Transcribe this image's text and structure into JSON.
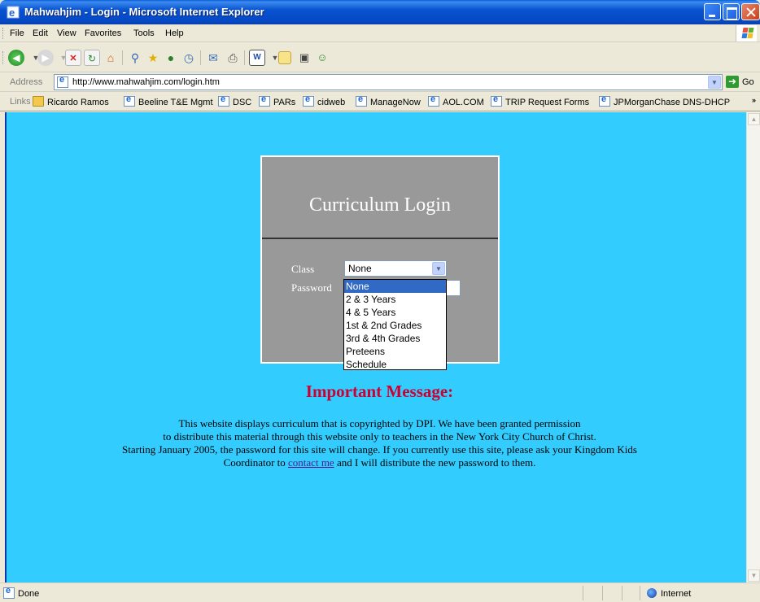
{
  "window": {
    "title": "Mahwahjim - Login - Microsoft Internet Explorer"
  },
  "menubar": {
    "items": [
      "File",
      "Edit",
      "View",
      "Favorites",
      "Tools",
      "Help"
    ]
  },
  "toolbar": {
    "icons": [
      "back-icon",
      "forward-icon",
      "stop-icon",
      "refresh-icon",
      "home-icon",
      "search-icon",
      "favorites-icon",
      "media-icon",
      "history-icon",
      "mail-icon",
      "print-icon",
      "edit-icon",
      "discuss-icon",
      "messenger-icon",
      "research-icon"
    ]
  },
  "addressbar": {
    "label": "Address",
    "url": "http://www.mahwahjim.com/login.htm",
    "go_label": "Go"
  },
  "linksbar": {
    "label": "Links",
    "items": [
      "Ricardo Ramos",
      "Beeline T&E Mgmt",
      "DSC",
      "PARs",
      "cidweb",
      "ManageNow",
      "AOL.COM",
      "TRIP Request Forms",
      "JPMorganChase DNS-DHCP"
    ]
  },
  "login": {
    "heading": "Curriculum Login",
    "class_label": "Class",
    "password_label": "Password",
    "class_value": "None",
    "options": [
      "None",
      "2 & 3 Years",
      "4 & 5 Years",
      "1st & 2nd Grades",
      "3rd & 4th Grades",
      "Preteens",
      "Schedule"
    ],
    "selected_index": 0
  },
  "message": {
    "title": "Important Message:",
    "line1": "This website displays curriculum that is copyrighted by DPI. We have been granted permission",
    "line2": "to distribute this material through this website only to teachers in the New York City Church of Christ.",
    "line3": "Starting January 2005, the password for this site will change. If you currently use this site, please ask your Kingdom Kids",
    "line4_before": "Coordinator to",
    "link": "contact me",
    "line4_after": "and I will distribute the new password to them."
  },
  "statusbar": {
    "status": "Done",
    "zone": "Internet"
  },
  "colors": {
    "page_background": "#33ccff",
    "login_box": "#999999",
    "message_title": "#cc0033",
    "titlebar": "#0853d0"
  }
}
